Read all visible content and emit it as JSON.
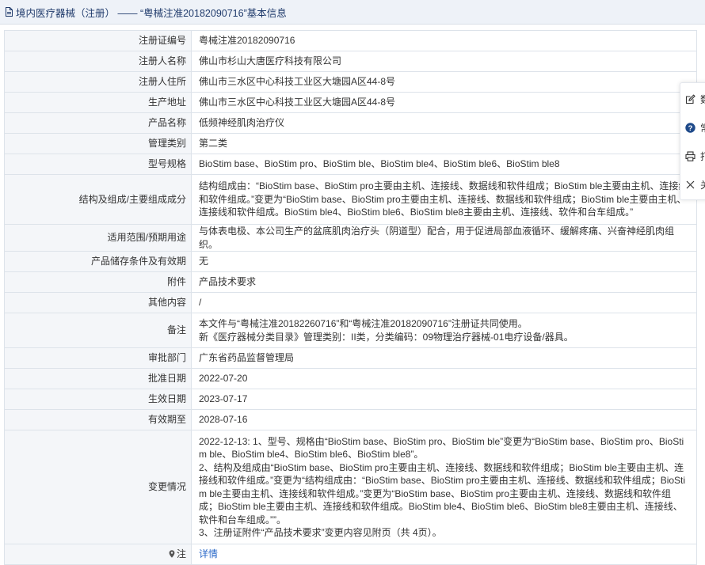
{
  "header": {
    "icon": "document-icon",
    "title": "境内医疗器械（注册） —— “粤械注准20182090716”基本信息"
  },
  "rows": [
    {
      "key": "注册证编号",
      "value": "粤械注准20182090716"
    },
    {
      "key": "注册人名称",
      "value": "佛山市杉山大唐医疗科技有限公司"
    },
    {
      "key": "注册人住所",
      "value": "佛山市三水区中心科技工业区大塘园A区44-8号"
    },
    {
      "key": "生产地址",
      "value": "佛山市三水区中心科技工业区大塘园A区44-8号"
    },
    {
      "key": "产品名称",
      "value": "低频神经肌肉治疗仪"
    },
    {
      "key": "管理类别",
      "value": "第二类"
    },
    {
      "key": "型号规格",
      "value": "BioStim base、BioStim pro、BioStim ble、BioStim ble4、BioStim ble6、BioStim ble8"
    },
    {
      "key": "结构及组成/主要组成成分",
      "value": "结构组成由：“BioStim base、BioStim pro主要由主机、连接线、数据线和软件组成；BioStim ble主要由主机、连接线和软件组成。”变更为“BioStim base、BioStim pro主要由主机、连接线、数据线和软件组成；BioStim ble主要由主机、连接线和软件组成。BioStim ble4、BioStim ble6、BioStim ble8主要由主机、连接线、软件和台车组成。”"
    },
    {
      "key": "适用范围/预期用途",
      "value": "与体表电极、本公司生产的盆底肌肉治疗头（阴道型）配合，用于促进局部血液循环、缓解疼痛、兴奋神经肌肉组织。"
    },
    {
      "key": "产品储存条件及有效期",
      "value": "无"
    },
    {
      "key": "附件",
      "value": "产品技术要求"
    },
    {
      "key": "其他内容",
      "value": "/"
    },
    {
      "key": "备注",
      "value_lines": [
        "本文件与“粤械注准20182260716”和“粤械注准20182090716”注册证共同使用。",
        "新《医疗器械分类目录》管理类别：II类，分类编码：09物理治疗器械-01电疗设备/器具。"
      ]
    },
    {
      "key": "审批部门",
      "value": "广东省药品监督管理局"
    },
    {
      "key": "批准日期",
      "value": "2022-07-20"
    },
    {
      "key": "生效日期",
      "value": "2023-07-17"
    },
    {
      "key": "有效期至",
      "value": "2028-07-16"
    },
    {
      "key": "变更情况",
      "value_lines": [
        "2022-12-13: 1、型号、规格由“BioStim base、BioStim pro、BioStim ble”变更为“BioStim base、BioStim pro、BioStim ble、BioStim ble4、BioStim ble6、BioStim ble8”。",
        "2、结构及组成由“BioStim base、BioStim pro主要由主机、连接线、数据线和软件组成；BioStim ble主要由主机、连接线和软件组成。”变更为“结构组成由：“BioStim base、BioStim pro主要由主机、连接线、数据线和软件组成；BioStim ble主要由主机、连接线和软件组成。”变更为“BioStim base、BioStim pro主要由主机、连接线、数据线和软件组成；BioStim ble主要由主机、连接线和软件组成。BioStim ble4、BioStim ble6、BioStim ble8主要由主机、连接线、软件和台车组成。””。",
        "3、注册证附件“产品技术要求”变更内容见附页（共 4页）。"
      ]
    }
  ],
  "note_row": {
    "icon": "location-pin-icon",
    "key": "注",
    "link": "详情"
  },
  "side_panel": [
    {
      "icon": "edit-icon",
      "label": "数"
    },
    {
      "icon": "help-icon",
      "label": "常"
    },
    {
      "icon": "print-icon",
      "label": "打"
    },
    {
      "icon": "close-icon",
      "label": "关"
    }
  ],
  "colors": {
    "header_bg": "#eef2f8",
    "header_text": "#1f3a6b",
    "key_bg": "#f4f6f9",
    "border": "#dde3ea",
    "link": "#2a68c8"
  }
}
